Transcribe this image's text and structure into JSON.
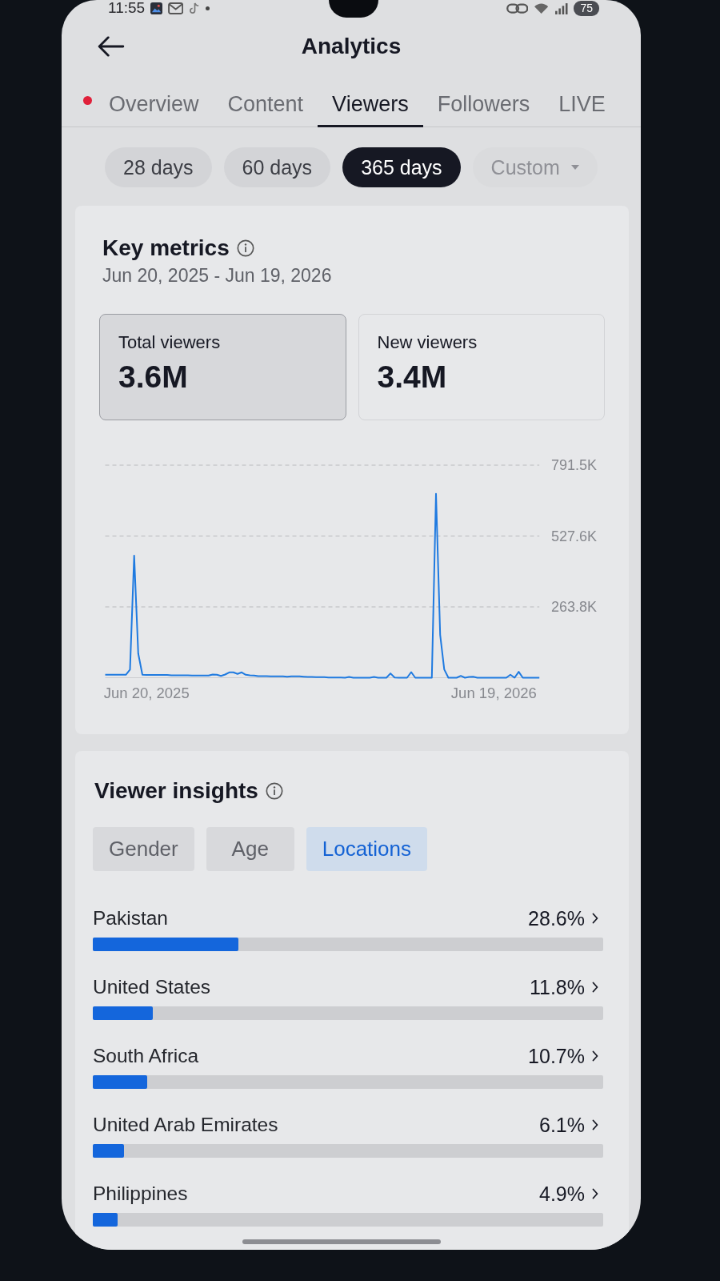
{
  "status_bar": {
    "time": "11:55",
    "battery": "75"
  },
  "header": {
    "title": "Analytics"
  },
  "tabs": {
    "offscreen_badge": true,
    "items": [
      {
        "label": "Overview",
        "selected": false
      },
      {
        "label": "Content",
        "selected": false
      },
      {
        "label": "Viewers",
        "selected": true
      },
      {
        "label": "Followers",
        "selected": false
      },
      {
        "label": "LIVE",
        "selected": false
      }
    ]
  },
  "ranges": [
    {
      "label": "28 days",
      "kind": "chip",
      "selected": false,
      "disabled": false
    },
    {
      "label": "60 days",
      "kind": "chip",
      "selected": false,
      "disabled": false
    },
    {
      "label": "365 days",
      "kind": "chip",
      "selected": true,
      "disabled": false
    },
    {
      "label": "Custom",
      "kind": "dropdown",
      "selected": false,
      "disabled": true
    }
  ],
  "key_metrics": {
    "title": "Key metrics",
    "date_range": "Jun 20, 2025 - Jun 19, 2026",
    "metrics": [
      {
        "label": "Total viewers",
        "value": "3.6M",
        "selected": true
      },
      {
        "label": "New viewers",
        "value": "3.4M",
        "selected": false
      }
    ],
    "chart_data": {
      "type": "line",
      "categories": [
        null,
        null,
        null,
        null,
        null,
        null,
        null,
        null,
        null,
        null,
        "Jun 20, 2025",
        null,
        null,
        null,
        null,
        null,
        null,
        null,
        null,
        null,
        null,
        null,
        null,
        null,
        null,
        null,
        null,
        null,
        null,
        null,
        null,
        null,
        null,
        null,
        null,
        null,
        null,
        null,
        null,
        null,
        null,
        null,
        null,
        null,
        null,
        null,
        null,
        null,
        null,
        null,
        null,
        null,
        null,
        null,
        null,
        null,
        null,
        null,
        null,
        null,
        null,
        null,
        null,
        null,
        null,
        null,
        null,
        null,
        null,
        null,
        null,
        null,
        null,
        null,
        null,
        null,
        null,
        null,
        null,
        null,
        null,
        null,
        null,
        null,
        null,
        null,
        null,
        null,
        null,
        null,
        null,
        null,
        null,
        null,
        "Jun 19, 2026",
        null,
        null,
        null,
        null,
        null,
        null,
        null,
        null,
        null,
        null,
        null
      ],
      "series": [
        {
          "color": "#1f7ae0",
          "values": [
            11000,
            11000,
            11000,
            11000,
            11000,
            11000,
            30000,
            455000,
            90000,
            11000,
            10000,
            10000,
            10000,
            10000,
            10000,
            10000,
            9000,
            9000,
            9000,
            9000,
            9000,
            8000,
            8000,
            8000,
            8000,
            8000,
            12000,
            11000,
            7000,
            12000,
            20000,
            20000,
            14000,
            20000,
            11000,
            9000,
            8000,
            6000,
            6000,
            6000,
            5000,
            5000,
            5000,
            5000,
            4000,
            5000,
            5000,
            5000,
            4000,
            3000,
            3000,
            2000,
            2000,
            2000,
            1000,
            1000,
            1000,
            1000,
            0,
            3000,
            0,
            0,
            0,
            0,
            0,
            3000,
            0,
            0,
            0,
            16000,
            1000,
            0,
            0,
            0,
            21000,
            0,
            0,
            0,
            0,
            0,
            685000,
            160000,
            31000,
            0,
            0,
            0,
            7000,
            0,
            3000,
            4000,
            0,
            0,
            0,
            0,
            0,
            0,
            0,
            0,
            11000,
            0,
            22000,
            0,
            0,
            0,
            0,
            0
          ]
        }
      ],
      "ylim": [
        0,
        791500
      ],
      "yticks": [
        {
          "value": 263800,
          "label": "263.8K"
        },
        {
          "value": 527600,
          "label": "527.6K"
        },
        {
          "value": 791500,
          "label": "791.5K"
        }
      ]
    }
  },
  "viewer_insights": {
    "title": "Viewer insights",
    "segments": [
      {
        "label": "Gender",
        "selected": false
      },
      {
        "label": "Age",
        "selected": false
      },
      {
        "label": "Locations",
        "selected": true
      }
    ],
    "locations": [
      {
        "name": "Pakistan",
        "share": "28.6%",
        "level": 0.286
      },
      {
        "name": "United States",
        "share": "11.8%",
        "level": 0.118
      },
      {
        "name": "South Africa",
        "share": "10.7%",
        "level": 0.107
      },
      {
        "name": "United Arab Emirates",
        "share": "6.1%",
        "level": 0.061
      },
      {
        "name": "Philippines",
        "share": "4.9%",
        "level": 0.049
      }
    ]
  }
}
